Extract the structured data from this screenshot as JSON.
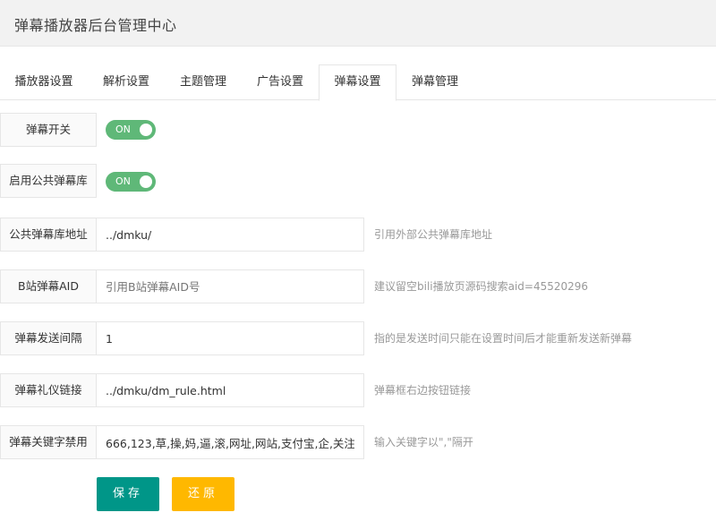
{
  "header": {
    "title": "弹幕播放器后台管理中心"
  },
  "tabs": [
    {
      "label": "播放器设置"
    },
    {
      "label": "解析设置"
    },
    {
      "label": "主题管理"
    },
    {
      "label": "广告设置"
    },
    {
      "label": "弹幕设置"
    },
    {
      "label": "弹幕管理"
    }
  ],
  "form": {
    "danmaku_switch": {
      "label": "弹幕开关",
      "state": "ON"
    },
    "public_lib_switch": {
      "label": "启用公共弹幕库",
      "state": "ON"
    },
    "public_lib_url": {
      "label": "公共弹幕库地址",
      "value": "../dmku/",
      "placeholder": "",
      "aux": "引用外部公共弹幕库地址"
    },
    "bili_aid": {
      "label": "B站弹幕AID",
      "value": "",
      "placeholder": "引用B站弹幕AID号",
      "aux": "建议留空bili播放页源码搜索aid=45520296"
    },
    "send_interval": {
      "label": "弹幕发送间隔",
      "value": "1",
      "placeholder": "",
      "aux": "指的是发送时间只能在设置时间后才能重新发送新弹幕"
    },
    "etiquette_link": {
      "label": "弹幕礼仪链接",
      "value": "../dmku/dm_rule.html",
      "placeholder": "",
      "aux": "弹幕框右边按钮链接"
    },
    "banned_keywords": {
      "label": "弹幕关键字禁用",
      "value": "666,123,草,操,妈,逼,滚,网址,网站,支付宝,企,关注",
      "placeholder": "",
      "aux": "输入关键字以\",\"隔开"
    }
  },
  "buttons": {
    "save": "保存",
    "reset": "还原"
  },
  "colors": {
    "switch_on": "#5fb878",
    "save": "#009688",
    "reset": "#ffb800"
  }
}
